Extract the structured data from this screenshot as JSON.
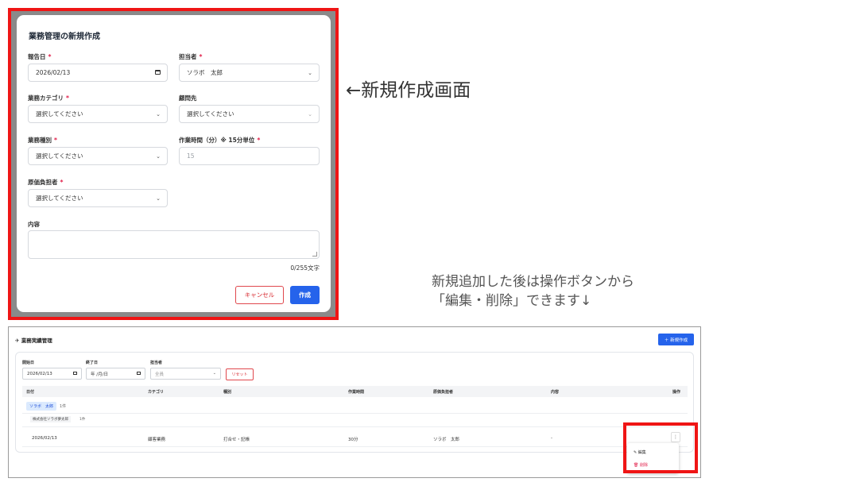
{
  "modal": {
    "title": "業務管理の新規作成",
    "fields": {
      "report_date": {
        "label": "報告日",
        "required": "*",
        "value": "2026/02/13"
      },
      "assignee": {
        "label": "担当者",
        "required": "*",
        "value": "ソラボ　太郎"
      },
      "category": {
        "label": "業務カテゴリ",
        "required": "*",
        "value": "選択してください"
      },
      "client": {
        "label": "顧問先",
        "value": "選択してください"
      },
      "work_type": {
        "label": "業務種別",
        "required": "*",
        "value": "選択してください"
      },
      "work_time": {
        "label": "作業時間（分）※ 15分単位",
        "required": "*",
        "placeholder": "15"
      },
      "cost_bearer": {
        "label": "原価負担者",
        "required": "*",
        "value": "選択してください"
      },
      "content": {
        "label": "内容",
        "counter": "0/255文字"
      }
    },
    "cancel_label": "キャンセル",
    "create_label": "作成"
  },
  "annotations": {
    "arrow_label": "←新規作成画面",
    "note_line1": "新規追加した後は操作ボタンから",
    "note_line2": "「編集・削除」できます↓"
  },
  "list": {
    "title": "業務実績管理",
    "title_icon": "paper-plane-icon",
    "new_button": "＋ 新規作成",
    "filters": {
      "start_label": "開始日",
      "start_value": "2026/02/13",
      "end_label": "終了日",
      "end_value": "年 /月/日",
      "assignee_label": "担当者",
      "assignee_value": "全員",
      "reset_label": "リセット"
    },
    "columns": [
      "日付",
      "カテゴリ",
      "種別",
      "作業時間",
      "原価負担者",
      "内容",
      "操作"
    ],
    "group": {
      "name": "ソラボ　太郎",
      "count": "1件"
    },
    "subgroup": {
      "name": "株式会社ソラボ夢太郎",
      "count": "1件"
    },
    "row": {
      "date": "2026/02/13",
      "category": "顧客業務",
      "type": "打合せ・記帳",
      "time": "30分",
      "bearer": "ソラボ　太郎",
      "content": "-",
      "action": "⋮"
    },
    "menu": {
      "edit": "編集",
      "delete": "削除"
    }
  },
  "colors": {
    "highlight": "#ef1515",
    "primary": "#2563eb",
    "danger": "#e11d48"
  }
}
